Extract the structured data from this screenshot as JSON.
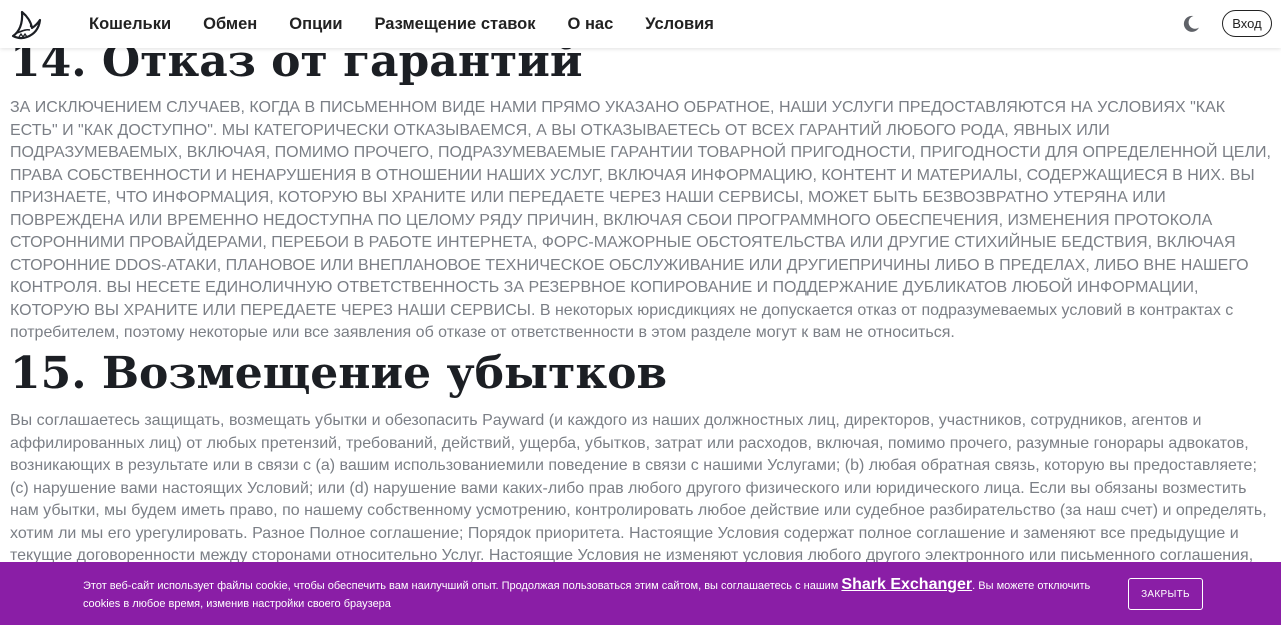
{
  "header": {
    "nav": [
      "Кошельки",
      "Обмен",
      "Опции",
      "Размещение ставок",
      "О нас",
      "Условия"
    ],
    "login_label": "Вход",
    "logo_icon": "shark-logo-icon",
    "theme_icon": "moon-icon"
  },
  "sections": {
    "s14": {
      "title": "14. Отказ от гарантий",
      "body": "ЗА ИСКЛЮЧЕНИЕМ СЛУЧАЕВ, КОГДА В ПИСЬМЕННОМ ВИДЕ НАМИ ПРЯМО УКАЗАНО ОБРАТНОЕ, НАШИ УСЛУГИ ПРЕДОСТАВЛЯЮТСЯ НА УСЛОВИЯХ \"КАК ЕСТЬ\" И \"КАК ДОСТУПНО\". МЫ КАТЕГОРИЧЕСКИ ОТКАЗЫВАЕМСЯ, А ВЫ ОТКАЗЫВАЕТЕСЬ ОТ ВСЕХ ГАРАНТИЙ ЛЮБОГО РОДА, ЯВНЫХ ИЛИ ПОДРАЗУМЕВАЕМЫХ, ВКЛЮЧАЯ, ПОМИМО ПРОЧЕГО, ПОДРАЗУМЕВАЕМЫЕ ГАРАНТИИ ТОВАРНОЙ ПРИГОДНОСТИ, ПРИГОДНОСТИ ДЛЯ ОПРЕДЕЛЕННОЙ ЦЕЛИ, ПРАВА СОБСТВЕННОСТИ И НЕНАРУШЕНИЯ В ОТНОШЕНИИ НАШИХ УСЛУГ, ВКЛЮЧАЯ ИНФОРМАЦИЮ, КОНТЕНТ И МАТЕРИАЛЫ, СОДЕРЖАЩИЕСЯ В НИХ. ВЫ ПРИЗНАЕТЕ, ЧТО ИНФОРМАЦИЯ, КОТОРУЮ ВЫ ХРАНИТЕ ИЛИ ПЕРЕДАЕТЕ ЧЕРЕЗ НАШИ СЕРВИСЫ, МОЖЕТ БЫТЬ БЕЗВОЗВРАТНО УТЕРЯНА ИЛИ ПОВРЕЖДЕНА ИЛИ ВРЕМЕННО НЕДОСТУПНА ПО ЦЕЛОМУ РЯДУ ПРИЧИН, ВКЛЮЧАЯ СБОИ ПРОГРАММНОГО ОБЕСПЕЧЕНИЯ, ИЗМЕНЕНИЯ ПРОТОКОЛА СТОРОННИМИ ПРОВАЙДЕРАМИ, ПЕРЕБОИ В РАБОТЕ ИНТЕРНЕТА, ФОРС-МАЖОРНЫЕ ОБСТОЯТЕЛЬСТВА ИЛИ ДРУГИЕ СТИХИЙНЫЕ БЕДСТВИЯ, ВКЛЮЧАЯ СТОРОННИЕ DDOS-АТАКИ, ПЛАНОВОЕ ИЛИ ВНЕПЛАНОВОЕ ТЕХНИЧЕСКОЕ ОБСЛУЖИВАНИЕ ИЛИ ДРУГИЕПРИЧИНЫ ЛИБО В ПРЕДЕЛАХ, ЛИБО ВНЕ НАШЕГО КОНТРОЛЯ. ВЫ НЕСЕТЕ ЕДИНОЛИЧНУЮ ОТВЕТСТВЕННОСТЬ ЗА РЕЗЕРВНОЕ КОПИРОВАНИЕ И ПОДДЕРЖАНИЕ ДУБЛИКАТОВ ЛЮБОЙ ИНФОРМАЦИИ, КОТОРУЮ ВЫ ХРАНИТЕ ИЛИ ПЕРЕДАЕТЕ ЧЕРЕЗ НАШИ СЕРВИСЫ. В некоторых юрисдикциях не допускается отказ от подразумеваемых условий в контрактах с потребителем, поэтому некоторые или все заявления об отказе от ответственности в этом разделе могут к вам не относиться."
    },
    "s15": {
      "title": "15. Возмещение убытков",
      "body": "Вы соглашаетесь защищать, возмещать убытки и обезопасить Payward (и каждого из наших должностных лиц, директоров, участников, сотрудников, агентов и аффилированных лиц) от любых претензий, требований, действий, ущерба, убытков, затрат или расходов, включая, помимо прочего, разумные гонорары адвокатов, возникающих в результате или в связи с (a) вашим использованиемили поведение в связи с нашими Услугами; (b) любая обратная связь, которую вы предоставляете; (c) нарушение вами настоящих Условий; или (d) нарушение вами каких-либо прав любого другого физического или юридического лица. Если вы обязаны возместить нам убытки, мы будем иметь право, по нашему собственному усмотрению, контролировать любое действие или судебное разбирательство (за наш счет) и определять, хотим ли мы его урегулировать. Разное Полное соглашение; Порядок приоритета. Настоящие Условия содержат полное соглашение и заменяют все предыдущие и текущие договоренности между сторонами относительно Услуг. Настоящие Условия не изменяют условия любого другого электронного или письменного соглашения,"
    }
  },
  "cookie": {
    "text_before": "Этот веб-сайт использует файлы cookie, чтобы обеспечить вам наилучший опыт. Продолжая пользоваться этим сайтом, вы соглашаетесь с нашим ",
    "link": "Shark Exchanger",
    "text_after": ". Вы можете отключить cookies в любое время, изменив настройки своего браузера",
    "close_label": "ЗАКРЫТЬ"
  },
  "colors": {
    "banner": "#8a1ea6",
    "heading": "#1c1f24",
    "body_text": "#7b7f86"
  }
}
